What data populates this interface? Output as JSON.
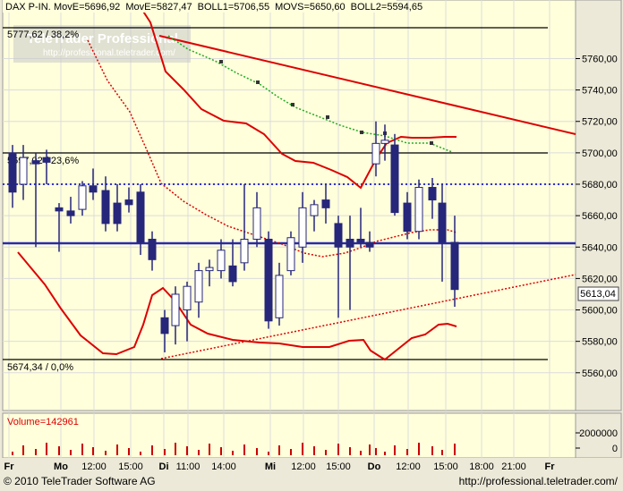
{
  "header": {
    "instrument": "DAX P-IN.",
    "indicators": [
      {
        "text": "MovE=5696,92",
        "color": "#22aa22"
      },
      {
        "text": "MovE=5827,47",
        "color": "#22aa22"
      },
      {
        "text": "BOLL1=5706,55",
        "color": "#cc0000"
      },
      {
        "text": "MOVS=5650,60",
        "color": "#cc0000"
      },
      {
        "text": "BOLL2=5594,65",
        "color": "#cc0000"
      }
    ]
  },
  "watermark": {
    "brand": "TeleTrader Professional",
    "url": "http://professional.teletrader.com/"
  },
  "fib_labels": {
    "top": "5777,62 / 38,2%",
    "mid": "5697,02 / 23,6%",
    "bottom": "5674,34 / 0,0%"
  },
  "current_price": "5613,04",
  "volume_label": "Volume=142961",
  "footer": {
    "copyright": "© 2010 TeleTrader Software AG",
    "url": "http://professional.teletrader.com/"
  },
  "colors": {
    "plot_bg": "#ffffdc",
    "candle": "#26267a",
    "accent_red": "#dd0000",
    "support_blue": "#2a2aaa",
    "ma_green": "#22aa22"
  },
  "chart_data": {
    "type": "candlestick",
    "y_ticks": [
      "5760,00",
      "5740,00",
      "5720,00",
      "5700,00",
      "5680,00",
      "5660,00",
      "5640,00",
      "5620,00",
      "5600,00",
      "5580,00",
      "5560,00"
    ],
    "ylim": [
      5550,
      5785
    ],
    "x_ticks": [
      "Fr",
      "Mo",
      "12:00",
      "15:00",
      "Di",
      "11:00",
      "14:00",
      "Mi",
      "12:00",
      "15:00",
      "Do",
      "12:00",
      "15:00",
      "18:00",
      "21:00",
      "Fr"
    ],
    "volume_ticks": [
      "2000000",
      "0"
    ],
    "candles": [
      {
        "o": 5700,
        "h": 5705,
        "l": 5665,
        "c": 5675
      },
      {
        "o": 5680,
        "h": 5705,
        "l": 5670,
        "c": 5697
      },
      {
        "o": 5695,
        "h": 5700,
        "l": 5640,
        "c": 5693
      },
      {
        "o": 5697,
        "h": 5702,
        "l": 5680,
        "c": 5694
      },
      {
        "o": 5665,
        "h": 5668,
        "l": 5637,
        "c": 5663
      },
      {
        "o": 5663,
        "h": 5672,
        "l": 5655,
        "c": 5660
      },
      {
        "o": 5664,
        "h": 5682,
        "l": 5660,
        "c": 5679
      },
      {
        "o": 5679,
        "h": 5690,
        "l": 5670,
        "c": 5675
      },
      {
        "o": 5676,
        "h": 5685,
        "l": 5650,
        "c": 5655
      },
      {
        "o": 5668,
        "h": 5680,
        "l": 5650,
        "c": 5655
      },
      {
        "o": 5670,
        "h": 5678,
        "l": 5662,
        "c": 5667
      },
      {
        "o": 5675,
        "h": 5680,
        "l": 5635,
        "c": 5643
      },
      {
        "o": 5645,
        "h": 5650,
        "l": 5625,
        "c": 5632
      },
      {
        "o": 5595,
        "h": 5600,
        "l": 5573,
        "c": 5585
      },
      {
        "o": 5590,
        "h": 5615,
        "l": 5578,
        "c": 5610
      },
      {
        "o": 5600,
        "h": 5618,
        "l": 5580,
        "c": 5615
      },
      {
        "o": 5605,
        "h": 5630,
        "l": 5595,
        "c": 5625
      },
      {
        "o": 5625,
        "h": 5632,
        "l": 5615,
        "c": 5627
      },
      {
        "o": 5625,
        "h": 5645,
        "l": 5620,
        "c": 5638
      },
      {
        "o": 5628,
        "h": 5645,
        "l": 5615,
        "c": 5618
      },
      {
        "o": 5630,
        "h": 5680,
        "l": 5625,
        "c": 5645
      },
      {
        "o": 5645,
        "h": 5675,
        "l": 5640,
        "c": 5665
      },
      {
        "o": 5645,
        "h": 5650,
        "l": 5588,
        "c": 5593
      },
      {
        "o": 5595,
        "h": 5630,
        "l": 5590,
        "c": 5622
      },
      {
        "o": 5625,
        "h": 5650,
        "l": 5622,
        "c": 5646
      },
      {
        "o": 5640,
        "h": 5675,
        "l": 5630,
        "c": 5665
      },
      {
        "o": 5660,
        "h": 5670,
        "l": 5650,
        "c": 5667
      },
      {
        "o": 5670,
        "h": 5680,
        "l": 5655,
        "c": 5665
      },
      {
        "o": 5655,
        "h": 5660,
        "l": 5595,
        "c": 5640
      },
      {
        "o": 5645,
        "h": 5660,
        "l": 5600,
        "c": 5640
      },
      {
        "o": 5645,
        "h": 5665,
        "l": 5640,
        "c": 5643
      },
      {
        "o": 5643,
        "h": 5650,
        "l": 5637,
        "c": 5640
      },
      {
        "o": 5693,
        "h": 5720,
        "l": 5685,
        "c": 5706
      },
      {
        "o": 5706,
        "h": 5718,
        "l": 5695,
        "c": 5708
      },
      {
        "o": 5705,
        "h": 5712,
        "l": 5660,
        "c": 5662
      },
      {
        "o": 5668,
        "h": 5675,
        "l": 5645,
        "c": 5650
      },
      {
        "o": 5650,
        "h": 5683,
        "l": 5645,
        "c": 5678
      },
      {
        "o": 5678,
        "h": 5684,
        "l": 5658,
        "c": 5670
      },
      {
        "o": 5668,
        "h": 5680,
        "l": 5618,
        "c": 5643
      },
      {
        "o": 5643,
        "h": 5660,
        "l": 5602,
        "c": 5613
      }
    ]
  }
}
